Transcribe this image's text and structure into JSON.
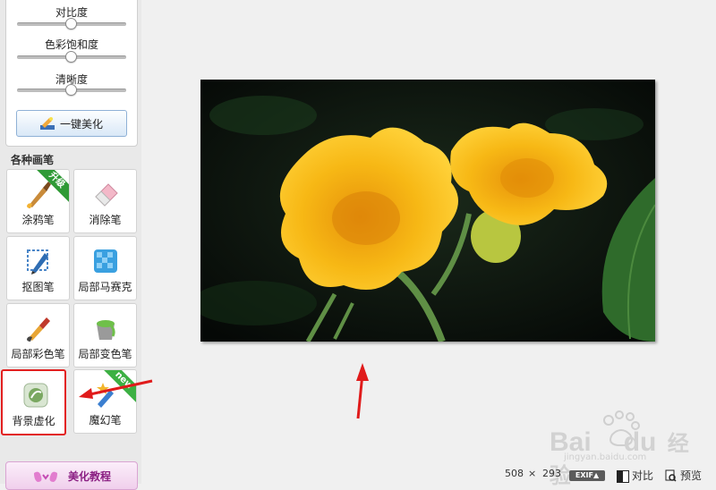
{
  "adjust": {
    "sliders": [
      {
        "label": "对比度",
        "level": 0.5
      },
      {
        "label": "色彩饱和度",
        "level": 0.5
      },
      {
        "label": "清晰度",
        "level": 0.5
      }
    ],
    "one_click_label": "一键美化"
  },
  "brushes": {
    "section_title": "各种画笔",
    "items": [
      {
        "label": "涂鸦笔",
        "icon": "paintbrush-icon",
        "badge": "升级"
      },
      {
        "label": "消除笔",
        "icon": "eraser-icon"
      },
      {
        "label": "抠图笔",
        "icon": "cutout-pen-icon"
      },
      {
        "label": "局部马赛克",
        "icon": "mosaic-icon"
      },
      {
        "label": "局部彩色笔",
        "icon": "color-brush-icon"
      },
      {
        "label": "局部变色笔",
        "icon": "paint-bucket-icon"
      },
      {
        "label": "背景虚化",
        "icon": "blur-icon",
        "selected": true
      },
      {
        "label": "魔幻笔",
        "icon": "magic-pen-icon",
        "badge": "new"
      }
    ]
  },
  "tutorial_label": "美化教程",
  "status": {
    "width": "508",
    "times": "×",
    "height": "293",
    "exif": "EXIF▲",
    "compare": "对比",
    "preview": "预览"
  },
  "watermark": {
    "brand": "Bai",
    "brand_tail": "du",
    "cn": "经验",
    "url": "jingyan.baidu.com"
  },
  "colors": {
    "selection": "#e21f1f",
    "badge_upgrade": "#2f9a36",
    "badge_new": "#3cb043",
    "flower": "#f7b815"
  }
}
